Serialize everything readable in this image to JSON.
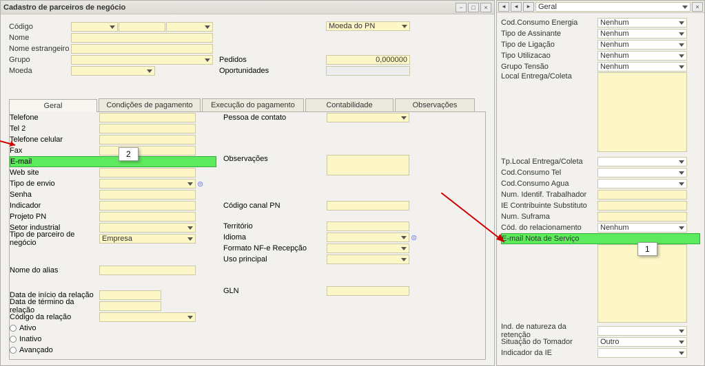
{
  "window": {
    "title": "Cadastro de parceiros de negócio"
  },
  "header": {
    "codigo_label": "Código",
    "nome_label": "Nome",
    "nome_estr_label": "Nome estrangeiro",
    "grupo_label": "Grupo",
    "moeda_label": "Moeda",
    "pedidos_label": "Pedidos",
    "pedidos_value": "0,000000",
    "oportunidades_label": "Oportunidades",
    "moeda_do_pn_label": "Moeda do PN"
  },
  "tabs": {
    "geral": "Geral",
    "cond": "Condições de pagamento",
    "exec": "Execução do pagamento",
    "cont": "Contabilidade",
    "obs": "Observações"
  },
  "geral_left": {
    "telefone": "Telefone",
    "tel2": "Tel 2",
    "tel_cel": "Telefone celular",
    "fax": "Fax",
    "email": "E-mail",
    "website": "Web site",
    "tipo_envio": "Tipo de envio",
    "senha": "Senha",
    "indicador": "Indicador",
    "projeto": "Projeto PN",
    "setor": "Setor industrial",
    "tipo_parc": "Tipo de parceiro de negócio",
    "tipo_parc_val": "Empresa",
    "alias": "Nome do alias",
    "data_ini": "Data de início da relação",
    "data_fim": "Data de término da relação",
    "cod_rel": "Código da relação",
    "ativo": "Ativo",
    "inativo": "Inativo",
    "avancado": "Avançado"
  },
  "geral_right": {
    "pessoa": "Pessoa de contato",
    "observ": "Observações",
    "cod_canal": "Código canal PN",
    "territorio": "Território",
    "idioma": "Idioma",
    "formato": "Formato NF-e Recepção",
    "uso": "Uso principal",
    "gln": "GLN"
  },
  "callouts": {
    "c1": "1",
    "c2": "2"
  },
  "side": {
    "combo": "Geral",
    "cod_energia": "Cod.Consumo Energia",
    "tipo_assin": "Tipo de Assinante",
    "tipo_lig": "Tipo de Ligação",
    "tipo_util": "Tipo Utilizacao",
    "grupo_tensao": "Grupo Tensão",
    "local_entrega": "Local Entrega/Coleta",
    "tp_local": "Tp.Local Entrega/Coleta",
    "cod_tel": "Cod.Consumo Tel",
    "cod_agua": "Cod.Consumo Agua",
    "num_trab": "Num. Identif. Trabalhador",
    "ie_sub": "IE Contribuinte Substituto",
    "suframa": "Num. Suframa",
    "cod_rel": "Cód. do relacionamento",
    "email_nfs": "E-mail Nota de Serviço",
    "ind_nat": "Ind. de natureza da retenção",
    "sit_tom": "Situação do Tomador",
    "ind_ie": "Indicador da IE",
    "nenhum": "Nenhum",
    "outro": "Outro"
  }
}
